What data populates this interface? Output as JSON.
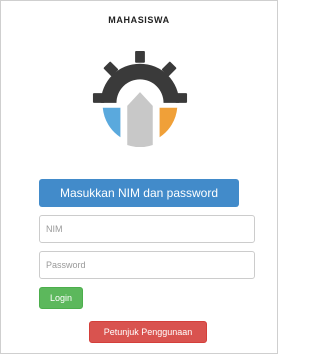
{
  "header": {
    "title": "MAHASISWA"
  },
  "logo": {
    "icon": "gear-logo-icon",
    "colors": {
      "gear": "#3a3a3a",
      "left_segment": "#5aa9dd",
      "middle_segment": "#c8c8c8",
      "right_segment": "#f0a038"
    }
  },
  "form": {
    "banner": "Masukkan NIM dan password",
    "nim_placeholder": "NIM",
    "password_placeholder": "Password",
    "login_label": "Login",
    "help_label": "Petunjuk Penggunaan"
  },
  "colors": {
    "banner": "#428bca",
    "login": "#5cb85c",
    "help": "#d9534f"
  }
}
